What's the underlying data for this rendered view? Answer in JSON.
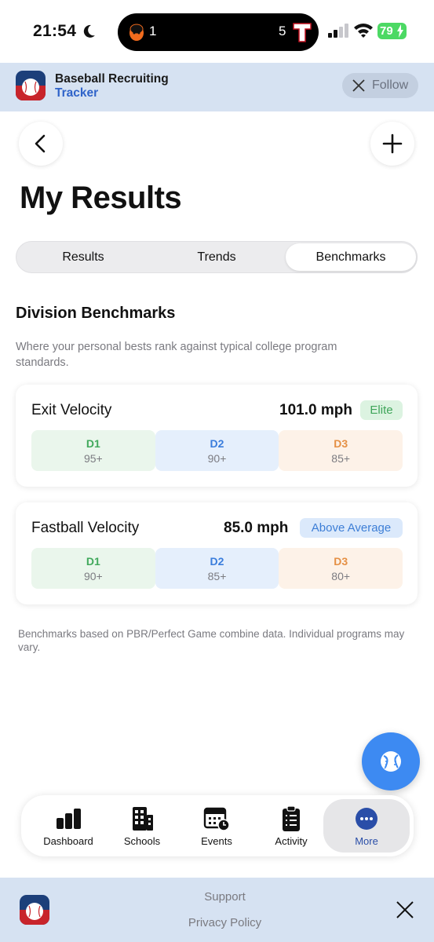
{
  "status_bar": {
    "time": "21:54",
    "score_left": "1",
    "score_right": "5",
    "battery": "79"
  },
  "app_banner": {
    "title": "Baseball Recruiting",
    "subtitle": "Tracker",
    "follow_label": "Follow"
  },
  "page": {
    "title": "My Results"
  },
  "segments": [
    "Results",
    "Trends",
    "Benchmarks"
  ],
  "selected_segment": "Benchmarks",
  "section": {
    "title": "Division Benchmarks",
    "description": "Where your personal bests rank against typical college program standards."
  },
  "benchmarks": [
    {
      "name": "Exit Velocity",
      "value": "101.0 mph",
      "badge": "Elite",
      "tiers": [
        {
          "label": "D1",
          "value": "95+"
        },
        {
          "label": "D2",
          "value": "90+"
        },
        {
          "label": "D3",
          "value": "85+"
        }
      ]
    },
    {
      "name": "Fastball Velocity",
      "value": "85.0 mph",
      "badge": "Above Average",
      "tiers": [
        {
          "label": "D1",
          "value": "90+"
        },
        {
          "label": "D2",
          "value": "85+"
        },
        {
          "label": "D3",
          "value": "80+"
        }
      ]
    }
  ],
  "footnote": "Benchmarks based on PBR/Perfect Game combine data. Individual programs may vary.",
  "tabbar": [
    {
      "label": "Dashboard",
      "icon": "bar-chart-icon"
    },
    {
      "label": "Schools",
      "icon": "building-icon"
    },
    {
      "label": "Events",
      "icon": "calendar-clock-icon"
    },
    {
      "label": "Activity",
      "icon": "clipboard-icon"
    },
    {
      "label": "More",
      "icon": "more-icon"
    }
  ],
  "selected_tab": "More",
  "footer_links": [
    "Support",
    "Privacy Policy"
  ],
  "colors": {
    "accent": "#3d8af2",
    "banner_bg": "#d6e2f2",
    "elite_green": "#3fa55a",
    "above_avg_blue": "#3d7ed6",
    "d1": "#41a95c",
    "d2": "#3a7ddc",
    "d3": "#e59045"
  }
}
